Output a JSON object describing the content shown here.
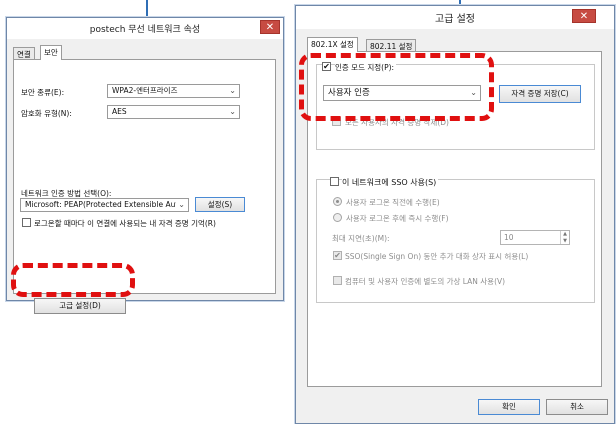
{
  "left_window": {
    "title": "postech 무선 네트워크 속성",
    "close": "✕",
    "tabs": [
      {
        "label": "연결"
      },
      {
        "label": "보안"
      }
    ],
    "security_type_label": "보안 종류(E):",
    "security_type_value": "WPA2-엔터프라이즈",
    "encryption_type_label": "암호화 유형(N):",
    "encryption_type_value": "AES",
    "auth_method_label": "네트워크 인증 방법 선택(O):",
    "auth_method_value": "Microsoft: PEAP(Protected Extensible Auth",
    "settings_button": "설정(S)",
    "remember_checkbox_label": "로그온할 때마다 이 연결에 사용되는 내 자격 증명 기억(R)",
    "advanced_button": "고급 설정(D)"
  },
  "right_window": {
    "title": "고급 설정",
    "close": "✕",
    "tabs": [
      {
        "label": "802.1X 설정"
      },
      {
        "label": "802.11 설정"
      }
    ],
    "specify_auth_mode_label": "인증 모드 지정(P):",
    "auth_mode_value": "사용자 인증",
    "save_credentials_button": "자격 증명 저장(C)",
    "delete_credentials_label": "모든 사용자의 자격 증명 삭제(D)",
    "sso_label": "이 네트워크에 SSO 사용(S)",
    "sso_before_logon": "사용자 로그온 직전에 수행(E)",
    "sso_after_logon": "사용자 로그온 후에 즉시 수행(F)",
    "max_delay_label": "최대 지연(초)(M):",
    "max_delay_value": "10",
    "sso_dialogs_label": "SSO(Single Sign On) 동안 추가 대화 상자 표시 허용(L)",
    "separate_vlan_label": "컴퓨터 및 사용자 인증에 별도의 가상 LAN 사용(V)",
    "ok_button": "확인",
    "cancel_button": "취소"
  },
  "colors": {
    "highlight_dash": "#e01010",
    "connector": "#2f6eb5",
    "close_button": "#c74b42"
  }
}
